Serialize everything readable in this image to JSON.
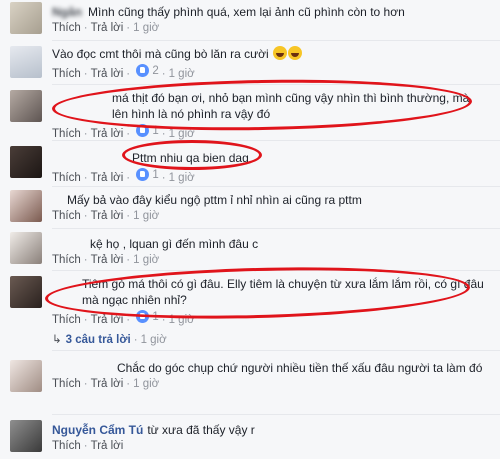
{
  "labels": {
    "like": "Thích",
    "reply": "Trả lời",
    "dot": "·"
  },
  "comments": [
    {
      "name": "Ngân",
      "text": "Mình cũng thấy phình quá, xem lại ảnh cũ phình còn to hơn",
      "likes": "",
      "time": "1 giờ"
    },
    {
      "name": "",
      "text": "Vào đọc cmt thôi mà cũng bò lăn ra cười",
      "likes": "2",
      "time": "1 giờ",
      "reactions": [
        "like-icon",
        "haha-icon"
      ],
      "emoji": [
        "laughing-emoji",
        "laughing-emoji"
      ]
    },
    {
      "name": "",
      "text": "má thịt đó bạn ơi, nhỏ bạn mình cũng vậy nhìn thì bình thường, mà lên hình là nó phình ra vậy đó",
      "likes": "1",
      "time": "1 giờ"
    },
    {
      "name": "",
      "text": "Pttm nhiu qa bien dag",
      "likes": "1",
      "time": "1 giờ"
    },
    {
      "name": "",
      "text": "Mấy bả vào đây kiểu ngộ pttm ỉ nhỉ nhìn ai cũng ra pttm",
      "likes": "",
      "time": "1 giờ"
    },
    {
      "name": "",
      "text": "kệ họ , lquan gì đến mình đâu c",
      "likes": "",
      "time": "1 giờ"
    },
    {
      "name": "",
      "text": "Tiêm gò má thôi có gì đâu. Elly tiêm là chuyện từ xưa lắm lắm rồi, có gì đâu mà ngạc nhiên nhỉ?",
      "likes": "1",
      "time": "1 giờ",
      "replies": "3 câu trả lời"
    },
    {
      "name": "",
      "text": "Chắc do góc chụp chứ người nhiều tiền thế xấu đâu người ta làm đó",
      "likes": "",
      "time": "1 giờ"
    },
    {
      "name": "Nguyễn Cẩm Tú",
      "text": "từ xưa đã thấy vậy r",
      "likes": "",
      "time": ""
    }
  ],
  "colors": {
    "accent": "#365899",
    "highlight": "#e0141b",
    "like": "#5890ff"
  }
}
